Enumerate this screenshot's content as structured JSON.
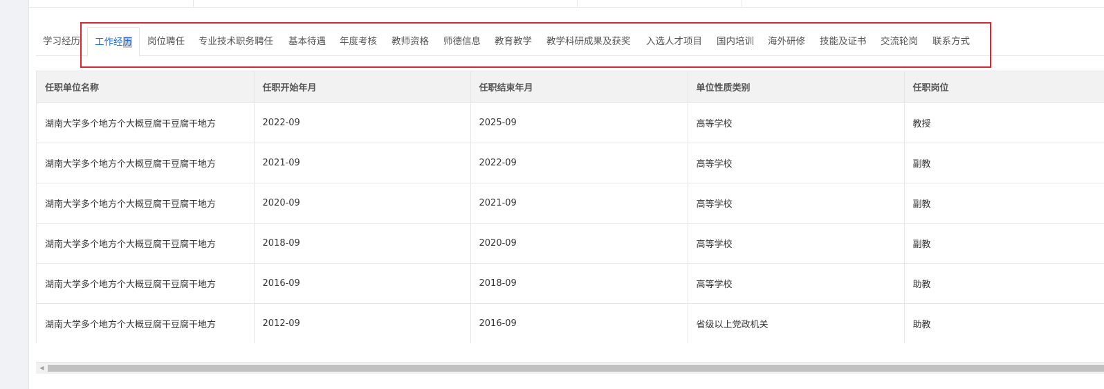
{
  "tabs": [
    {
      "label": "学习经历"
    },
    {
      "label": "工作经",
      "tail": "历"
    },
    {
      "label": "岗位聘任"
    },
    {
      "label": "专业技术职务聘任"
    },
    {
      "label": "基本待遇"
    },
    {
      "label": "年度考核"
    },
    {
      "label": "教师资格"
    },
    {
      "label": "师德信息"
    },
    {
      "label": "教育教学"
    },
    {
      "label": "教学科研成果及获奖"
    },
    {
      "label": "入选人才项目"
    },
    {
      "label": "国内培训"
    },
    {
      "label": "海外研修"
    },
    {
      "label": "技能及证书"
    },
    {
      "label": "交流轮岗"
    },
    {
      "label": "联系方式"
    }
  ],
  "active_tab": "工作经历",
  "colors": {
    "active_tab": "#1e6fd9",
    "highlight_border": "#e8202a",
    "header_bg": "#f2f2f2"
  },
  "table": {
    "headers": [
      "任职单位名称",
      "任职开始年月",
      "任职结束年月",
      "单位性质类别",
      "任职岗位"
    ],
    "rows": [
      [
        "湖南大学多个地方个大概豆腐干豆腐干地方",
        "2022-09",
        "2025-09",
        "高等学校",
        "教授"
      ],
      [
        "湖南大学多个地方个大概豆腐干豆腐干地方",
        "2021-09",
        "2022-09",
        "高等学校",
        "副教"
      ],
      [
        "湖南大学多个地方个大概豆腐干豆腐干地方",
        "2020-09",
        "2021-09",
        "高等学校",
        "副教"
      ],
      [
        "湖南大学多个地方个大概豆腐干豆腐干地方",
        "2018-09",
        "2020-09",
        "高等学校",
        "副教"
      ],
      [
        "湖南大学多个地方个大概豆腐干豆腐干地方",
        "2016-09",
        "2018-09",
        "高等学校",
        "助教"
      ],
      [
        "湖南大学多个地方个大概豆腐干豆腐干地方",
        "2012-09",
        "2016-09",
        "省级以上党政机关",
        "助教"
      ]
    ]
  },
  "scrollbar": {
    "left_arrow_icon": "scroll-left-icon",
    "arrow_glyph": "◀"
  }
}
